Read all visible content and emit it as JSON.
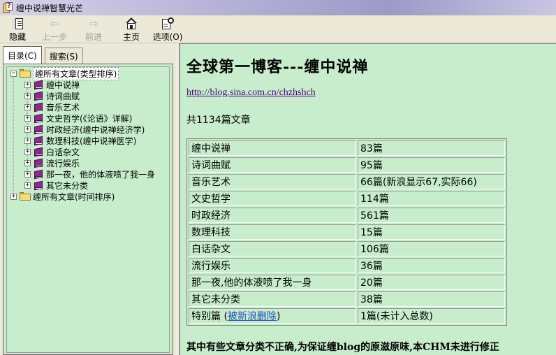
{
  "window": {
    "title": "缠中说禅智慧光芒"
  },
  "toolbar": {
    "hide_label": "隐藏",
    "back_label": "上一步",
    "forward_label": "前进",
    "home_label": "主页",
    "options_label": "选项(O)"
  },
  "tabs": {
    "contents_label": "目录(C)",
    "search_label": "搜索(S)"
  },
  "tree": {
    "root1": "缠所有文章(类型排序)",
    "items": [
      "缠中说禅",
      "诗词曲赋",
      "音乐艺术",
      "文史哲学(《论语》详解)",
      "时政经济(缠中说禅经济学)",
      "数理科技(缠中说禅医学)",
      "白话杂文",
      "流行娱乐",
      "那一夜，他的体液喷了我一身",
      "其它未分类"
    ],
    "root2": "缠所有文章(时间排序)"
  },
  "content": {
    "heading": "全球第一博客---缠中说禅",
    "url": "http://blog.sina.com.cn/chzhshch",
    "article_count": "共1134篇文章",
    "table": [
      {
        "category": "缠中说禅",
        "count": "83篇"
      },
      {
        "category": "诗词曲赋",
        "count": "95篇"
      },
      {
        "category": "音乐艺术",
        "count": "66篇(新浪显示67,实际66)"
      },
      {
        "category": "文史哲学",
        "count": "114篇"
      },
      {
        "category": "时政经济",
        "count": "561篇"
      },
      {
        "category": "数理科技",
        "count": "15篇"
      },
      {
        "category": "白话杂文",
        "count": "106篇"
      },
      {
        "category": "流行娱乐",
        "count": "36篇"
      },
      {
        "category": "那一夜,他的体液喷了我一身",
        "count": "20篇"
      },
      {
        "category": "其它未分类",
        "count": "38篇"
      }
    ],
    "special": {
      "prefix": "特别篇 (",
      "link": "被新浪删除",
      "suffix": ")",
      "count": "1篇(未计入总数)"
    },
    "note": "其中有些文章分类不正确,为保证缠blog的原滋原味,本CHM未进行修正"
  }
}
